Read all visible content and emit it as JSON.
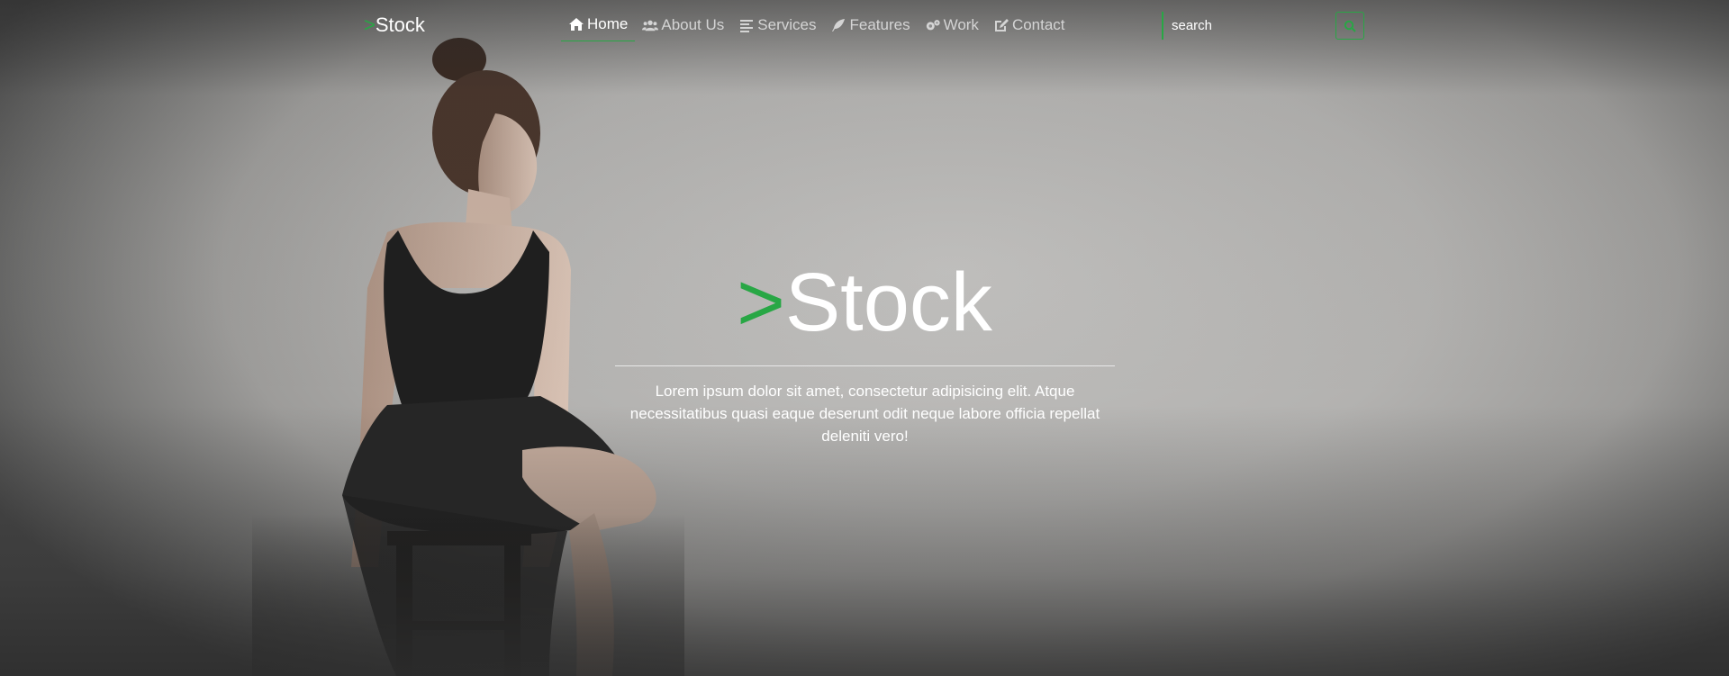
{
  "brand": {
    "prefix": ">",
    "name": "Stock"
  },
  "nav": {
    "items": [
      {
        "label": "Home",
        "icon": "home-icon",
        "active": true
      },
      {
        "label": "About Us",
        "icon": "users-icon",
        "active": false
      },
      {
        "label": "Services",
        "icon": "list-icon",
        "active": false
      },
      {
        "label": "Features",
        "icon": "feather-icon",
        "active": false
      },
      {
        "label": "Work",
        "icon": "gears-icon",
        "active": false
      },
      {
        "label": "Contact",
        "icon": "edit-icon",
        "active": false
      }
    ]
  },
  "search": {
    "placeholder": "search",
    "button_icon": "search-icon"
  },
  "hero": {
    "title_prefix": ">",
    "title": "Stock",
    "text": "Lorem ipsum dolor sit amet, consectetur adipisicing elit. Atque necessitatibus quasi eaque deserunt odit neque labore officia repellat deleniti vero!"
  },
  "colors": {
    "accent": "#28a745",
    "text": "#ffffff",
    "nav_text": "#d4d4d4"
  }
}
